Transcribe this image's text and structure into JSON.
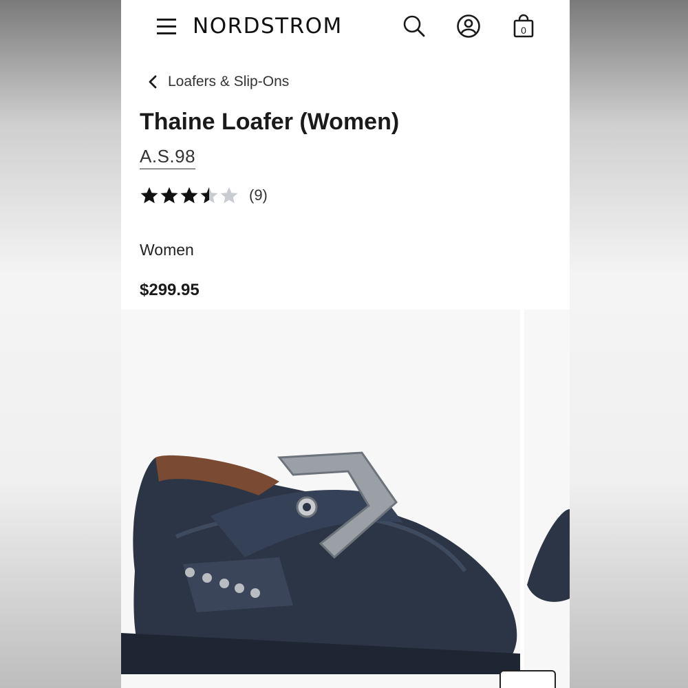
{
  "header": {
    "logo": "NORDSTROM",
    "bag_count": "0",
    "icons": [
      "menu-icon",
      "search-icon",
      "account-icon",
      "shopping-bag-icon"
    ]
  },
  "breadcrumb": {
    "label": "Loafers & Slip-Ons"
  },
  "product": {
    "title": "Thaine Loafer (Women)",
    "brand": "A.S.98",
    "rating": 3.5,
    "rating_max": 5,
    "review_count": "(9)",
    "gender": "Women",
    "price": "$299.95"
  },
  "colors": {
    "text": "#1a1a1a",
    "star_filled": "#111111",
    "star_empty": "#c9cdd1",
    "shoe": "#2c3545"
  }
}
